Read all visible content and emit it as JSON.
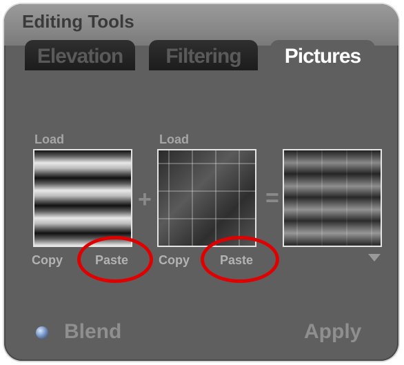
{
  "panel": {
    "title": "Editing Tools"
  },
  "tabs": [
    {
      "label": "Elevation",
      "active": false
    },
    {
      "label": "Filtering",
      "active": false
    },
    {
      "label": "Pictures",
      "active": true
    }
  ],
  "slots": {
    "first": {
      "load_label": "Load",
      "copy_label": "Copy",
      "paste_label": "Paste"
    },
    "second": {
      "load_label": "Load",
      "copy_label": "Copy",
      "paste_label": "Paste"
    }
  },
  "operators": {
    "plus": "+",
    "equals": "="
  },
  "bottom": {
    "blend_label": "Blend",
    "apply_label": "Apply"
  },
  "colors": {
    "highlight_ring": "#e00000",
    "panel_bg": "#5f5f5f"
  },
  "icons": {
    "dropdown": "chevron-down-icon",
    "blend_indicator": "radio-dot-icon"
  }
}
